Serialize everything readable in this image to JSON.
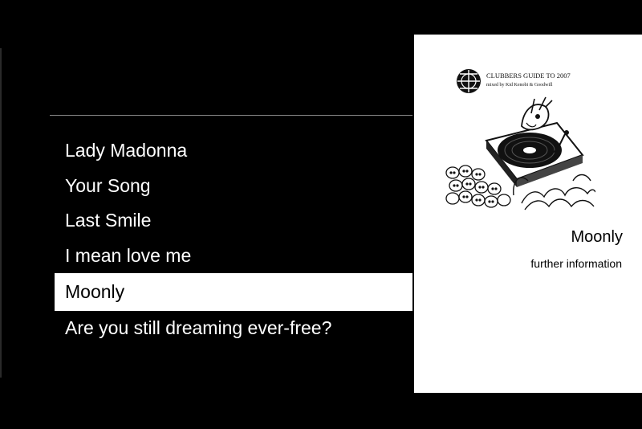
{
  "track_list": {
    "items": [
      {
        "label": "Lady Madonna"
      },
      {
        "label": "Your Song"
      },
      {
        "label": "Last Smile"
      },
      {
        "label": "I mean love me"
      },
      {
        "label": "Moonly",
        "selected": true
      },
      {
        "label": "Are you still dreaming ever-free?"
      }
    ]
  },
  "info_panel": {
    "cover": {
      "title_line": "CLUBBERS GUIDE TO 2007",
      "subtitle_line": "mixed by Kid Kenobi & Goodwill"
    },
    "title": "Moonly",
    "more_info_label": "further information"
  }
}
